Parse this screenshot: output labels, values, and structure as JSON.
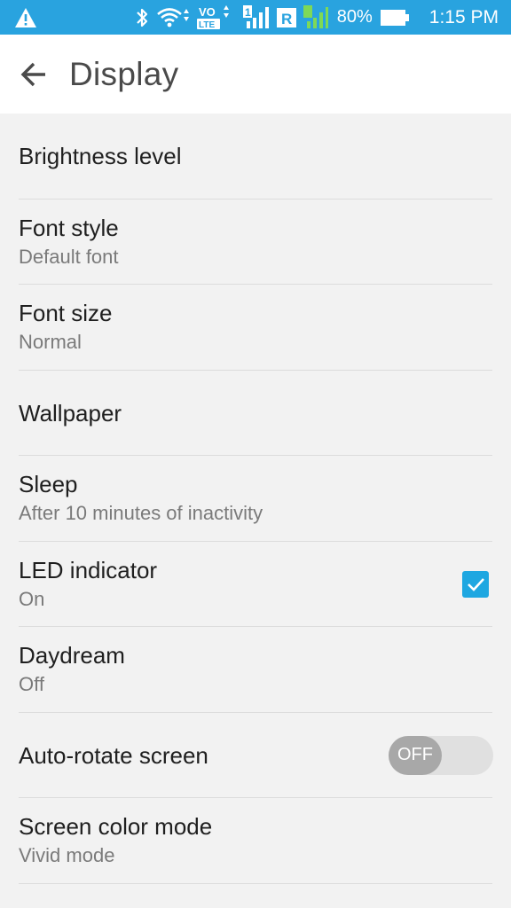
{
  "status_bar": {
    "battery_percent": "80%",
    "time": "1:15 PM",
    "volte_top": "VO",
    "volte_bottom": "LTE",
    "sim_label": "1",
    "roaming_label": "R",
    "icons": [
      "warning-icon",
      "bluetooth-icon",
      "wifi-icon",
      "volte-icon",
      "sim1-signal-icon",
      "roaming-icon",
      "sim2-signal-icon",
      "battery-icon"
    ]
  },
  "app_bar": {
    "title": "Display",
    "back_icon": "arrow-back-icon"
  },
  "settings": {
    "items": [
      {
        "title": "Brightness level"
      },
      {
        "title": "Font style",
        "summary": "Default font"
      },
      {
        "title": "Font size",
        "summary": "Normal"
      },
      {
        "title": "Wallpaper"
      },
      {
        "title": "Sleep",
        "summary": "After 10 minutes of inactivity"
      },
      {
        "title": "LED indicator",
        "summary": "On",
        "checked": true
      },
      {
        "title": "Daydream",
        "summary": "Off"
      },
      {
        "title": "Auto-rotate screen",
        "toggle_label": "OFF",
        "toggle_on": false
      },
      {
        "title": "Screen color mode",
        "summary": "Vivid mode"
      }
    ]
  },
  "colors": {
    "status_bar": "#29a3df",
    "accent": "#1ea7e1",
    "background": "#f2f2f2"
  }
}
